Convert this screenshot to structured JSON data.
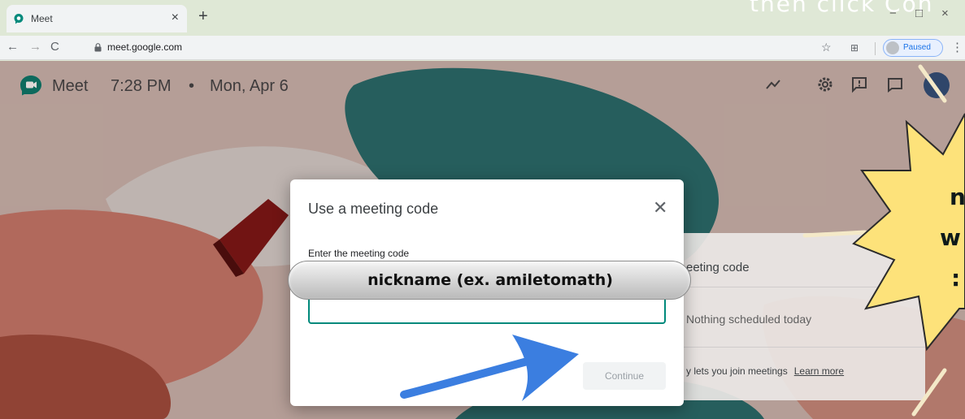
{
  "browser": {
    "tab_title": "Meet",
    "tab_close": "×",
    "new_tab": "+",
    "url": "meet.google.com",
    "profile_status": "Paused",
    "window_controls": [
      "−",
      "□",
      "×"
    ],
    "headline_fragment": "then click Con"
  },
  "header": {
    "brand": "Meet",
    "time": "7:28 PM",
    "separator": "•",
    "date": "Mon, Apr 6",
    "icons": [
      "activity-icon",
      "settings-icon",
      "feedback-icon",
      "avatar"
    ]
  },
  "side_card": {
    "row1": "eeting code",
    "row2": "Nothing scheduled today",
    "row3": "y lets you join meetings",
    "learn_more": "Learn more"
  },
  "dialog": {
    "title": "Use a meeting code",
    "close": "✕",
    "field_label": "Enter the meeting code",
    "input_value": "",
    "continue_label": "Continue"
  },
  "annotation": {
    "banner_text": "nickname (ex. amiletomath)",
    "starburst_lines": [
      "n",
      "w",
      ":"
    ],
    "starburst_color": "#fde27a",
    "arrow_color": "#3b7ee0"
  },
  "colors": {
    "chrome_bg": "#dfe8d6",
    "teal_shape": "#1f6b6b",
    "salmon_shape": "#c8786a",
    "accent_input": "#00897b"
  }
}
